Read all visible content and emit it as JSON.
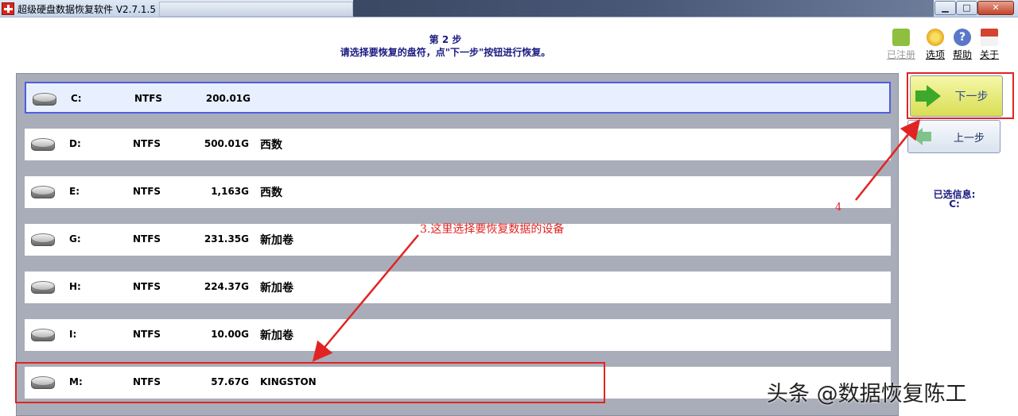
{
  "window": {
    "title": "超级硬盘数据恢复软件 V2.7.1.5",
    "controls": {
      "minimize": "▁",
      "maximize": "□",
      "close": "✕"
    }
  },
  "header": {
    "step_title": "第 2 步",
    "step_desc": "请选择要恢复的盘符，点\"下一步\"按钮进行恢复。"
  },
  "toolbar": {
    "items": [
      {
        "label": "已注册",
        "icon": "cart-icon",
        "enabled": false
      },
      {
        "label": "选项",
        "icon": "flower-gear-icon",
        "enabled": true
      },
      {
        "label": "帮助",
        "icon": "help-icon",
        "enabled": true
      },
      {
        "label": "关于",
        "icon": "house-icon",
        "enabled": true
      }
    ]
  },
  "disks": [
    {
      "letter": "C:",
      "fs": "NTFS",
      "size": "200.01G",
      "label": "",
      "selected": true
    },
    {
      "letter": "D:",
      "fs": "NTFS",
      "size": "500.01G",
      "label": "西数",
      "selected": false
    },
    {
      "letter": "E:",
      "fs": "NTFS",
      "size": "1,163G",
      "label": "西数",
      "selected": false
    },
    {
      "letter": "G:",
      "fs": "NTFS",
      "size": "231.35G",
      "label": "新加卷",
      "selected": false
    },
    {
      "letter": "H:",
      "fs": "NTFS",
      "size": "224.37G",
      "label": "新加卷",
      "selected": false
    },
    {
      "letter": "I:",
      "fs": "NTFS",
      "size": "10.00G",
      "label": "新加卷",
      "selected": false
    },
    {
      "letter": "M:",
      "fs": "NTFS",
      "size": "57.67G",
      "label": "KINGSTON",
      "selected": false
    }
  ],
  "nav": {
    "next_label": "下一步",
    "prev_label": "上一步"
  },
  "selection": {
    "label": "已选信息:",
    "value": "C:"
  },
  "annotations": {
    "step3": "3.这里选择要恢复数据的设备",
    "step4": "4",
    "color": "#e02424"
  },
  "watermark": "头条 @数据恢复陈工",
  "colors": {
    "selected_border": "#3d4fe0",
    "panel_bg": "#a9adb9",
    "text_blue": "#1a1a80"
  }
}
